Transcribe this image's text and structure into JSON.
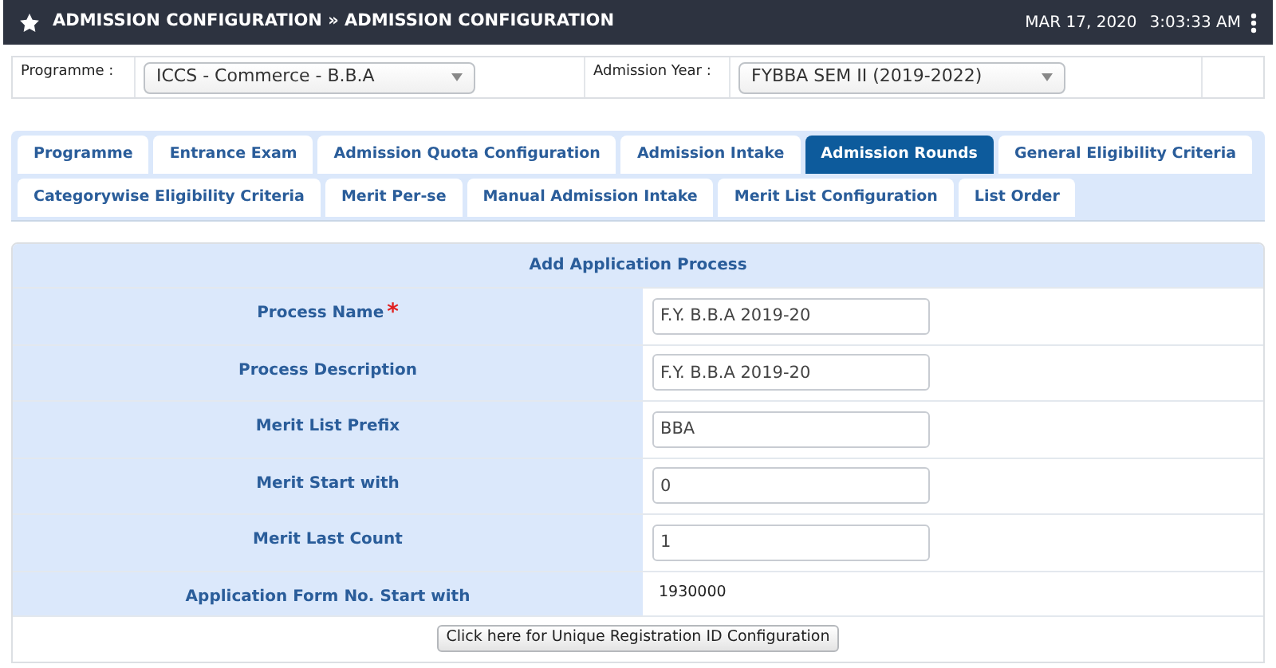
{
  "header": {
    "title": "ADMISSION CONFIGURATION » ADMISSION CONFIGURATION",
    "date": "MAR 17, 2020",
    "time": "3:03:33 AM"
  },
  "filters": [
    {
      "label": "Programme :",
      "value": "ICCS - Commerce - B.B.A"
    },
    {
      "label": "Admission Year :",
      "value": "FYBBA SEM II (2019-2022)"
    }
  ],
  "tabs": [
    [
      {
        "label": "Programme",
        "selected": false
      },
      {
        "label": "Entrance Exam",
        "selected": false
      },
      {
        "label": "Admission Quota Configuration",
        "selected": false
      },
      {
        "label": "Admission Intake",
        "selected": false
      },
      {
        "label": "Admission Rounds",
        "selected": true
      },
      {
        "label": "General Eligibility Criteria",
        "selected": false
      }
    ],
    [
      {
        "label": "Categorywise Eligibility Criteria",
        "selected": false
      },
      {
        "label": "Merit Per-se",
        "selected": false
      },
      {
        "label": "Manual Admission Intake",
        "selected": false
      },
      {
        "label": "Merit List Configuration",
        "selected": false
      },
      {
        "label": "List Order",
        "selected": false
      }
    ]
  ],
  "form": {
    "title": "Add Application Process",
    "rows": [
      {
        "label": "Process Name",
        "required_mark": "*",
        "kind": "input",
        "value": "F.Y. B.B.A 2019-20"
      },
      {
        "label": "Process Description",
        "kind": "input",
        "value": "F.Y. B.B.A 2019-20"
      },
      {
        "label": "Merit List Prefix",
        "kind": "input",
        "value": "BBA"
      },
      {
        "label": "Merit Start with",
        "kind": "input",
        "value": "0"
      },
      {
        "label": "Merit Last Count",
        "kind": "input",
        "value": "1"
      },
      {
        "label": "Application Form No. Start with",
        "kind": "text",
        "value": "1930000"
      }
    ],
    "button": "Click here for Unique Registration ID Configuration"
  }
}
